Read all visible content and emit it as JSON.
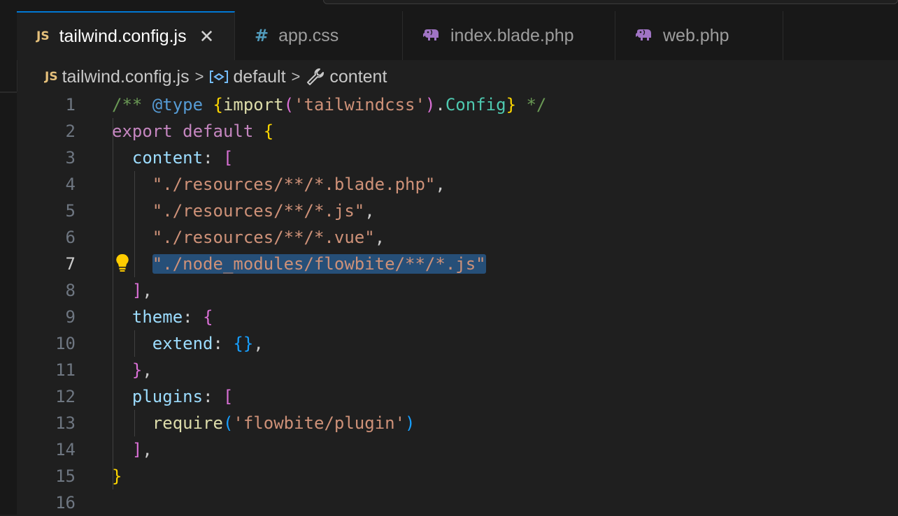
{
  "tabs": [
    {
      "label": "tailwind.config.js",
      "icon": "js-icon",
      "icon_text": "JS",
      "active": true,
      "close": "✕"
    },
    {
      "label": "app.css",
      "icon": "css-hash-icon",
      "icon_text": "#",
      "active": false
    },
    {
      "label": "index.blade.php",
      "icon": "php-elephant-icon",
      "active": false
    },
    {
      "label": "web.php",
      "icon": "php-elephant-icon",
      "active": false
    }
  ],
  "breadcrumb": {
    "file_icon_text": "JS",
    "file": "tailwind.config.js",
    "sep": ">",
    "symbol1": "default",
    "symbol1_icon": "variable-icon",
    "symbol2": "content",
    "symbol2_icon": "wrench-icon"
  },
  "editor": {
    "current_line": 7,
    "line_numbers": [
      "1",
      "2",
      "3",
      "4",
      "5",
      "6",
      "7",
      "8",
      "9",
      "10",
      "11",
      "12",
      "13",
      "14",
      "15",
      "16"
    ],
    "lines": [
      [
        [
          "c-comment",
          "/** "
        ],
        [
          "c-tag",
          "@type"
        ],
        [
          "c-comment",
          " "
        ],
        [
          "c-b1",
          "{"
        ],
        [
          "c-func",
          "import"
        ],
        [
          "c-b2",
          "("
        ],
        [
          "c-string",
          "'tailwindcss'"
        ],
        [
          "c-b2",
          ")"
        ],
        [
          "c-punc",
          "."
        ],
        [
          "c-type",
          "Config"
        ],
        [
          "c-b1",
          "}"
        ],
        [
          "c-comment",
          " */"
        ]
      ],
      [
        [
          "c-keyword",
          "export"
        ],
        [
          "c-punc",
          " "
        ],
        [
          "c-keyword",
          "default"
        ],
        [
          "c-punc",
          " "
        ],
        [
          "c-b1",
          "{"
        ]
      ],
      [
        [
          "c-punc",
          "  "
        ],
        [
          "c-prop",
          "content"
        ],
        [
          "c-punc",
          ": "
        ],
        [
          "c-b2",
          "["
        ]
      ],
      [
        [
          "c-punc",
          "    "
        ],
        [
          "c-string",
          "\"./resources/**/*.blade.php\""
        ],
        [
          "c-punc",
          ","
        ]
      ],
      [
        [
          "c-punc",
          "    "
        ],
        [
          "c-string",
          "\"./resources/**/*.js\""
        ],
        [
          "c-punc",
          ","
        ]
      ],
      [
        [
          "c-punc",
          "    "
        ],
        [
          "c-string",
          "\"./resources/**/*.vue\""
        ],
        [
          "c-punc",
          ","
        ]
      ],
      [
        [
          "c-punc",
          "    "
        ],
        [
          "c-string sel",
          "\"./node_modules/flowbite/**/*.js\""
        ]
      ],
      [
        [
          "c-punc",
          "  "
        ],
        [
          "c-b2",
          "]"
        ],
        [
          "c-punc",
          ","
        ]
      ],
      [
        [
          "c-punc",
          "  "
        ],
        [
          "c-prop",
          "theme"
        ],
        [
          "c-punc",
          ": "
        ],
        [
          "c-b2",
          "{"
        ]
      ],
      [
        [
          "c-punc",
          "    "
        ],
        [
          "c-prop",
          "extend"
        ],
        [
          "c-punc",
          ": "
        ],
        [
          "c-b3",
          "{}"
        ],
        [
          "c-punc",
          ","
        ]
      ],
      [
        [
          "c-punc",
          "  "
        ],
        [
          "c-b2",
          "}"
        ],
        [
          "c-punc",
          ","
        ]
      ],
      [
        [
          "c-punc",
          "  "
        ],
        [
          "c-prop",
          "plugins"
        ],
        [
          "c-punc",
          ": "
        ],
        [
          "c-b2",
          "["
        ]
      ],
      [
        [
          "c-punc",
          "    "
        ],
        [
          "c-func",
          "require"
        ],
        [
          "c-b3",
          "("
        ],
        [
          "c-string",
          "'flowbite/plugin'"
        ],
        [
          "c-b3",
          ")"
        ]
      ],
      [
        [
          "c-punc",
          "  "
        ],
        [
          "c-b2",
          "]"
        ],
        [
          "c-punc",
          ","
        ]
      ],
      [
        [
          "c-b1",
          "}"
        ]
      ],
      []
    ]
  },
  "colors": {
    "accent": "#0078d4",
    "selection": "#264f78",
    "lightbulb": "#ffcc00",
    "php_icon": "#a074c4"
  }
}
